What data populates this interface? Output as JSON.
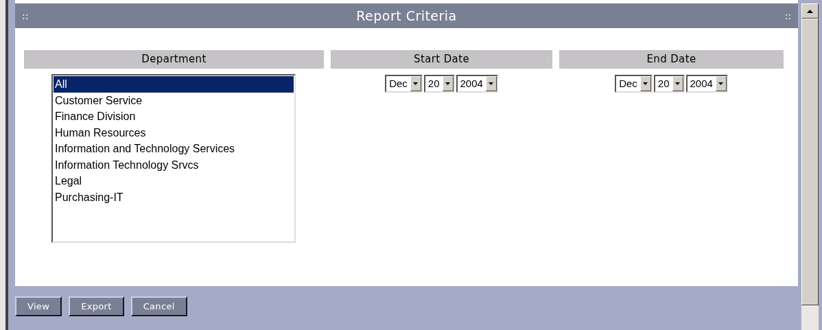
{
  "panel": {
    "title": "Report Criteria",
    "grip_left": "::",
    "grip_right": "::"
  },
  "department": {
    "label": "Department",
    "options": [
      {
        "label": "All",
        "selected": true
      },
      {
        "label": "Customer Service",
        "selected": false
      },
      {
        "label": "Finance Division",
        "selected": false
      },
      {
        "label": "Human Resources",
        "selected": false
      },
      {
        "label": "Information and Technology Services",
        "selected": false
      },
      {
        "label": "Information Technology Srvcs",
        "selected": false
      },
      {
        "label": "Legal",
        "selected": false
      },
      {
        "label": "Purchasing-IT",
        "selected": false
      }
    ]
  },
  "start_date": {
    "label": "Start Date",
    "month": "Dec",
    "day": "20",
    "year": "2004"
  },
  "end_date": {
    "label": "End Date",
    "month": "Dec",
    "day": "20",
    "year": "2004"
  },
  "buttons": [
    "View",
    "Export",
    "Cancel"
  ]
}
